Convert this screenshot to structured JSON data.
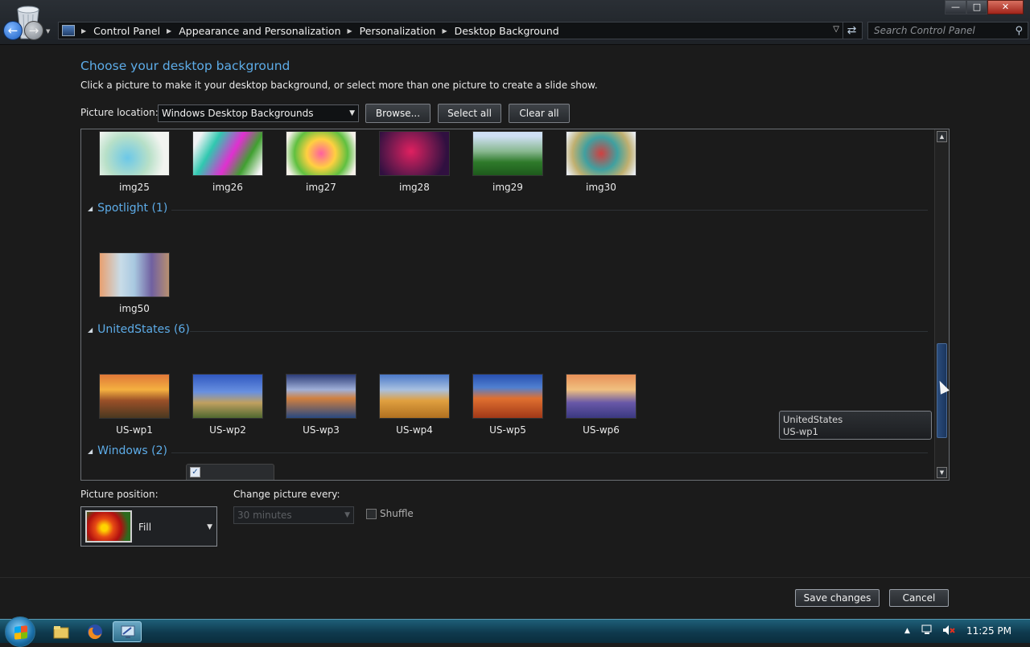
{
  "breadcrumb": [
    "Control Panel",
    "Appearance and Personalization",
    "Personalization",
    "Desktop Background"
  ],
  "search": {
    "placeholder": "Search Control Panel"
  },
  "window_controls": {
    "minimize": "—",
    "maximize": "□",
    "close": "✕"
  },
  "page": {
    "heading": "Choose your desktop background",
    "subtext": "Click a picture to make it your desktop background, or select more than one picture to create a slide show.",
    "picture_location_label": "Picture location:",
    "picture_location_value": "Windows Desktop Backgrounds",
    "browse_label": "Browse...",
    "select_all_label": "Select all",
    "clear_all_label": "Clear all"
  },
  "gallery": {
    "top_row": [
      "img25",
      "img26",
      "img27",
      "img28",
      "img29",
      "img30"
    ],
    "groups": [
      {
        "label": "Spotlight (1)",
        "items": [
          "img50"
        ]
      },
      {
        "label": "UnitedStates (6)",
        "items": [
          "US-wp1",
          "US-wp2",
          "US-wp3",
          "US-wp4",
          "US-wp5",
          "US-wp6"
        ]
      },
      {
        "label": "Windows (2)",
        "items": []
      }
    ],
    "tooltip": {
      "line1": "UnitedStates",
      "line2": "US-wp1"
    }
  },
  "position": {
    "label": "Picture position:",
    "value": "Fill"
  },
  "change": {
    "label": "Change picture every:",
    "value": "30 minutes",
    "shuffle_label": "Shuffle"
  },
  "footer": {
    "save_label": "Save changes",
    "cancel_label": "Cancel"
  },
  "taskbar": {
    "clock": "11:25 PM"
  },
  "icons": [
    "recycle-bin-icon",
    "back-icon",
    "forward-icon",
    "control-panel-icon",
    "refresh-icon",
    "search-icon",
    "folder-icon",
    "firefox-icon",
    "monitor-icon",
    "speaker-muted-icon",
    "network-icon",
    "windows-logo-icon"
  ]
}
